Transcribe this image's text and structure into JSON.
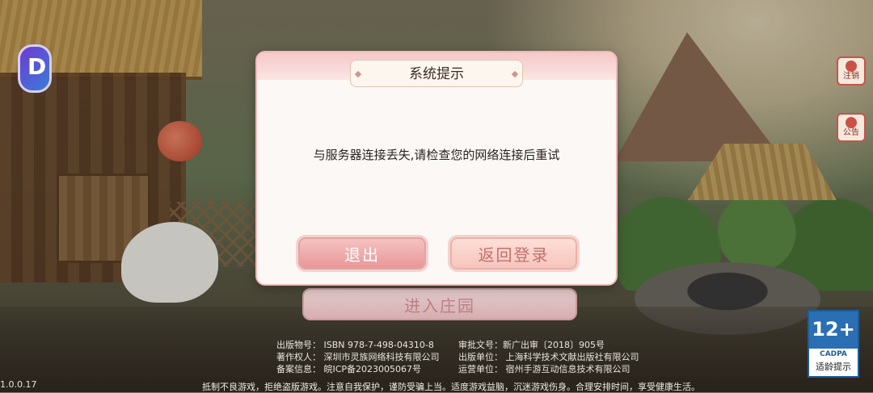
{
  "dialog": {
    "title": "系统提示",
    "message": "与服务器连接丢失,请检查您的网络连接后重试",
    "exit_button": "退出",
    "return_login_button": "返回登录"
  },
  "enter_button": "进入庄园",
  "side_buttons": {
    "logout": "注销",
    "notice": "公告"
  },
  "footer": {
    "left": [
      "出版物号： ISBN 978-7-498-04310-8",
      "著作权人： 深圳市灵族网络科技有限公司",
      "备案信息： 皖ICP备2023005067号"
    ],
    "right": [
      "审批文号：新广出审〔2018〕905号",
      "出版单位： 上海科学技术文献出版社有限公司",
      "运营单位： 宿州手游互动信息技术有限公司"
    ],
    "health_notice": "抵制不良游戏，拒绝盗版游戏。注意自我保护，谨防受骗上当。适度游戏益脑，沉迷游戏伤身。合理安排时间，享受健康生活。",
    "version": "1.0.0.17"
  },
  "age_rating": {
    "rating": "12+",
    "org": "CADPA",
    "label": "适龄提示"
  },
  "colors": {
    "dialog_border": "#efb8b8",
    "exit_button": "#e89595",
    "return_button": "#f6c4bc",
    "age_badge": "#2a6eb4"
  },
  "icons": {
    "logo": "game-logo-icon",
    "logout": "user-logout-icon",
    "notice": "notice-board-icon"
  }
}
